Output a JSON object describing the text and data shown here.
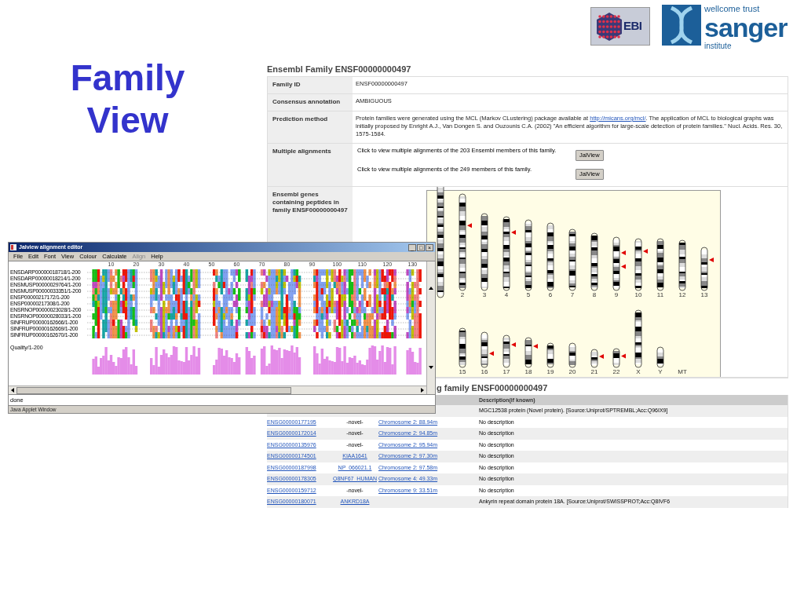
{
  "slide_title": [
    "Family",
    "View"
  ],
  "logos": [
    {
      "kind": "ebi",
      "text": "EBI"
    },
    {
      "kind": "sanger",
      "top": "wellcome trust",
      "name": "sanger",
      "bottom": "institute"
    }
  ],
  "web_page": {
    "title": "Ensembl Family ENSF00000000497",
    "info_rows": [
      {
        "kind": "text",
        "label": "Family ID",
        "value": "ENSF00000000497"
      },
      {
        "kind": "text",
        "label": "Consensus annotation",
        "value": "AMBIGUOUS"
      },
      {
        "kind": "prediction",
        "label": "Prediction method",
        "before": "Protein families were generated using the MCL (Markov CLustering) package available at ",
        "link": "http://micans.org/mcl/",
        "after": ". The application of MCL to biological graphs was initially proposed by Enright A.J., Van Dongen S. and Ouzounis C.A. (2002) \"An efficient algorithm for large-scale detection of protein families.\" Nucl. Acids. Res. 30, 1575-1584."
      },
      {
        "kind": "alignments",
        "label": "Multiple alignments",
        "items": [
          {
            "text": "Click to view multiple alignments of the 203 Ensembl members of this family.",
            "button": "JalView"
          },
          {
            "text": "Click to view multiple alignments of the 249 members of this family.",
            "button": "JalView"
          }
        ]
      },
      {
        "kind": "karyotype",
        "label": "Ensembl genes containing peptides in family ENSF00000000497",
        "top_row": [
          "2",
          "3",
          "4",
          "5",
          "6",
          "7",
          "8",
          "9",
          "10",
          "11",
          "12",
          "13"
        ],
        "bottom_row": [
          "15",
          "16",
          "17",
          "18",
          "19",
          "20",
          "21",
          "22",
          "X",
          "Y",
          "MT"
        ]
      }
    ],
    "genes_heading": "g family ENSF00000000497",
    "genes_header": "Description(if known)",
    "genes_rows": [
      {
        "description": "MGC12538 protein (Novel protein). [Source:Uniprot/SPTREMBL;Acc:Q96IX9]"
      },
      {
        "id": "ENSG00000177195",
        "name": "-novel-",
        "name_link": false,
        "location": "Chromosome 2: 88.94m",
        "description": "No description"
      },
      {
        "id": "ENSG00000172014",
        "name": "-novel-",
        "name_link": false,
        "location": "Chromosome 2: 94.85m",
        "description": "No description"
      },
      {
        "id": "ENSG00000135976",
        "name": "-novel-",
        "name_link": false,
        "location": "Chromosome 2: 95.94m",
        "description": "No description"
      },
      {
        "id": "ENSG00000174501",
        "name": "KIAA1641",
        "name_link": true,
        "location": "Chromosome 2: 97.30m",
        "description": "No description"
      },
      {
        "id": "ENSG00000187998",
        "name": "NP_066021.1",
        "name_link": true,
        "location": "Chromosome 2: 97.58m",
        "description": "No description"
      },
      {
        "id": "ENSG00000178305",
        "name": "Q8NF67_HUMAN",
        "name_link": true,
        "location": "Chromosome 4: 49.33m",
        "description": "No description"
      },
      {
        "id": "ENSG00000159712",
        "name": "-novel-",
        "name_link": false,
        "location": "Chromosome 9: 33.51m",
        "description": "No description"
      },
      {
        "id": "ENSG00000180071",
        "name": "ANKRD18A",
        "name_link": true,
        "description": "Ankyrin repeat domain protein 18A. [Source:Uniprot/SWISSPROT;Acc:Q8IVF6"
      }
    ]
  },
  "jalview": {
    "title": "Jalview alignment editor",
    "window_controls": [
      "_",
      "□",
      "×"
    ],
    "menu": [
      {
        "label": "File",
        "disabled": false
      },
      {
        "label": "Edit",
        "disabled": false
      },
      {
        "label": "Font",
        "disabled": false
      },
      {
        "label": "View",
        "disabled": false
      },
      {
        "label": "Colour",
        "disabled": false
      },
      {
        "label": "Calculate",
        "disabled": false
      },
      {
        "label": "Align",
        "disabled": true
      },
      {
        "label": "Help",
        "disabled": false
      }
    ],
    "ruler": [
      "10",
      "20",
      "30",
      "40",
      "50",
      "60",
      "70",
      "80",
      "90",
      "100",
      "110",
      "120",
      "130"
    ],
    "sequences": [
      "ENSDARP00000018718/1-200",
      "ENSDARP00000018214/1-200",
      "ENSMUSP00000029764/1-200",
      "ENSMUSP00000033351/1-200",
      "ENSP00000217172/1-200",
      "ENSP00000217308/1-200",
      "ENSRNOP00000023028/1-200",
      "ENSRNOP00000028033/1-200",
      "SINFRUP00000162666/1-200",
      "SINFRUP00000162669/1-200",
      "SINFRUP00000162670/1-200"
    ],
    "quality_label": "Quality/1-200",
    "status": "done",
    "footer": "Java Applet Window"
  }
}
